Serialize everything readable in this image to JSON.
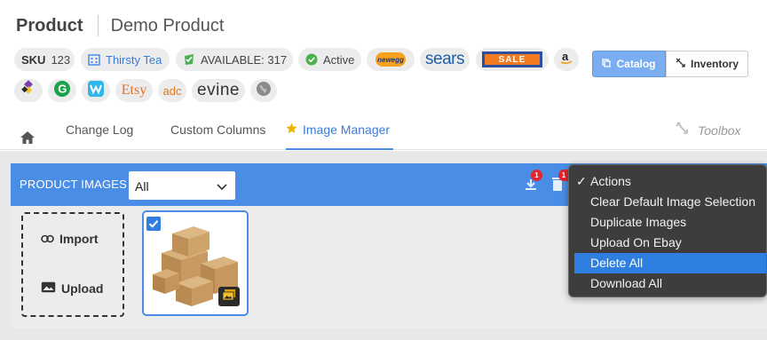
{
  "header": {
    "entity_type": "Product",
    "product_name": "Demo Product"
  },
  "chips": {
    "sku": {
      "label": "SKU",
      "value": "123"
    },
    "brand": {
      "text": "Thirsty Tea"
    },
    "available": {
      "text": "AVAILABLE: 317"
    },
    "status": {
      "text": "Active"
    }
  },
  "marketplaces": {
    "newegg": "newegg",
    "sears": "sears",
    "sale": "SALE",
    "etsy": "Etsy",
    "adc": "adc",
    "evine": "evine"
  },
  "view_toggle": {
    "catalog": "Catalog",
    "inventory": "Inventory"
  },
  "tabs": {
    "change_log": "Change Log",
    "custom_columns": "Custom Columns",
    "image_manager": "Image Manager",
    "toolbox": "Toolbox"
  },
  "product_images": {
    "label": "PRODUCT IMAGES",
    "filter": "All",
    "download_badge": "1",
    "delete_badge": "1"
  },
  "dropzone": {
    "import": "Import",
    "upload": "Upload"
  },
  "actions_menu": {
    "check": "✓",
    "title": "Actions",
    "items": [
      "Clear Default Image Selection",
      "Duplicate Images",
      "Upload On Ebay",
      "Delete All",
      "Download All"
    ]
  },
  "colors": {
    "accent": "#4a8de6",
    "highlight": "#2f7fe0",
    "menu_bg": "#3d3d3d",
    "tab_star": "#f0b400"
  }
}
